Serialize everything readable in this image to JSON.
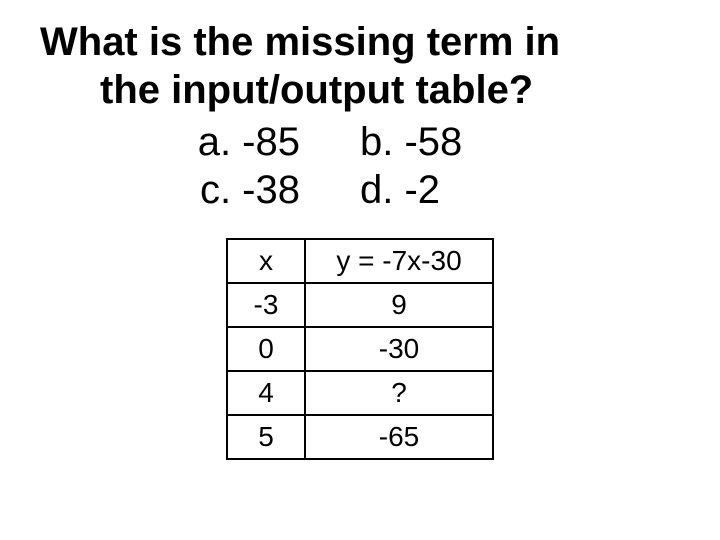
{
  "question": {
    "line1": "What is the missing term in",
    "line2": "the input/output table?"
  },
  "choices": {
    "a": "a. -85",
    "b": "b. -58",
    "c": "c. -38",
    "d": "d. -2"
  },
  "table": {
    "header": {
      "x": "x",
      "y": "y = -7x-30"
    },
    "rows": [
      {
        "x": "-3",
        "y": "9"
      },
      {
        "x": "0",
        "y": "-30"
      },
      {
        "x": "4",
        "y": "?"
      },
      {
        "x": "5",
        "y": "-65"
      }
    ]
  }
}
